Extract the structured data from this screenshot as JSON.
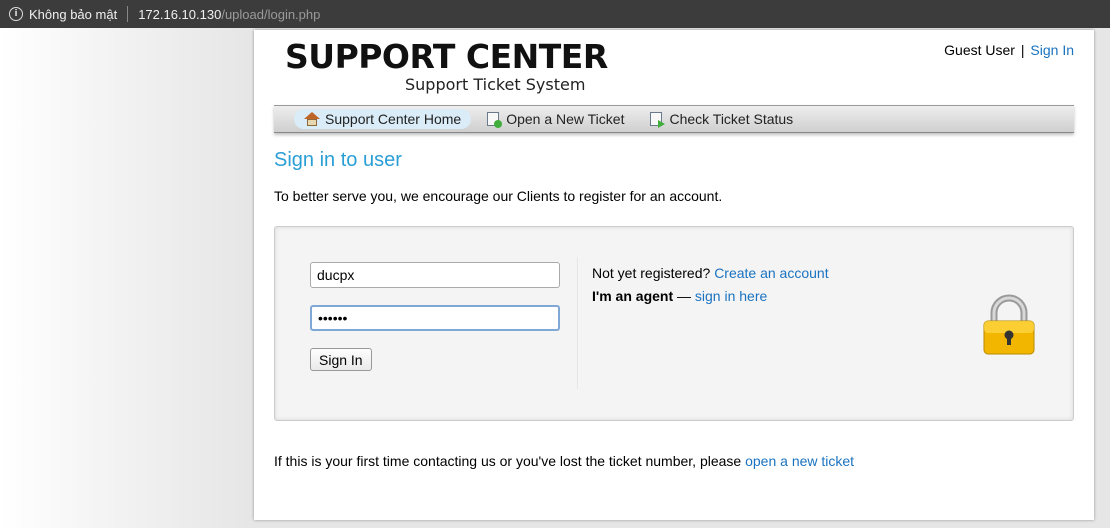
{
  "browser": {
    "security_label": "Không bảo mật",
    "url_host": "172.16.10.130",
    "url_path": "/upload/login.php"
  },
  "header": {
    "logo_title": "SUPPORT CENTER",
    "logo_subtitle": "Support Ticket System",
    "guest_label": "Guest User",
    "separator": "|",
    "sign_in_link": "Sign In"
  },
  "nav": {
    "items": [
      {
        "label": "Support Center Home",
        "icon": "home-icon",
        "active": true
      },
      {
        "label": "Open a New Ticket",
        "icon": "new-ticket-icon",
        "active": false
      },
      {
        "label": "Check Ticket Status",
        "icon": "ticket-status-icon",
        "active": false
      }
    ]
  },
  "main": {
    "title": "Sign in to user",
    "intro": "To better serve you, we encourage our Clients to register for an account."
  },
  "login": {
    "username_value": "ducpx",
    "password_value": "••••••",
    "sign_in_button": "Sign In",
    "not_registered_text": "Not yet registered?",
    "create_account_link": "Create an account",
    "agent_text": "I'm an agent",
    "agent_dash": "—",
    "agent_link": "sign in here"
  },
  "footer": {
    "text": "If this is your first time contacting us or you've lost the ticket number, please",
    "link": "open a new ticket"
  },
  "colors": {
    "accent": "#2a9fd6",
    "link": "#1a73c0",
    "lock_body": "#f2b600"
  }
}
